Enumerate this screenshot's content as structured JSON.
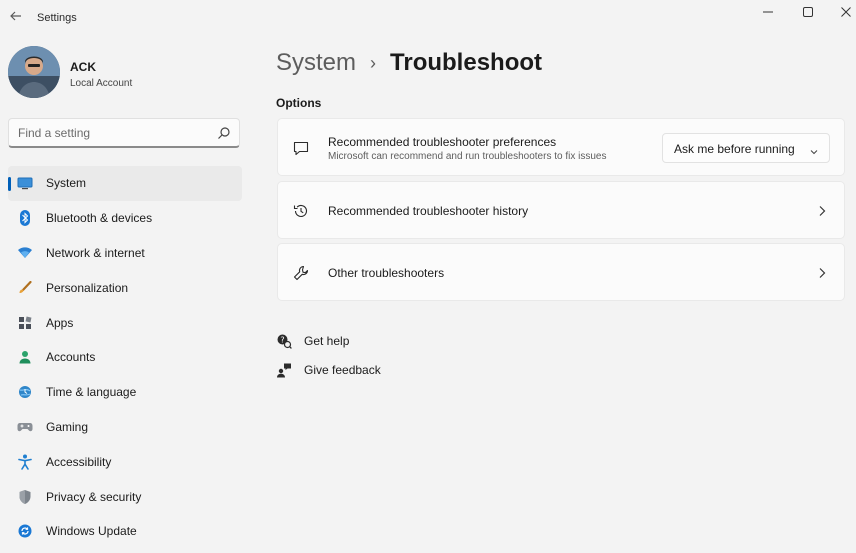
{
  "window": {
    "title": "Settings",
    "back_icon": "back-arrow-icon",
    "controls": [
      "minimize-icon",
      "maximize-icon",
      "close-icon"
    ]
  },
  "profile": {
    "name": "ACK",
    "account_type": "Local Account"
  },
  "search": {
    "placeholder": "Find a setting",
    "icon": "search-icon"
  },
  "sidebar": {
    "accent": "#005fb8",
    "items": [
      {
        "label": "System",
        "icon": "system-display-icon",
        "selected": true
      },
      {
        "label": "Bluetooth & devices",
        "icon": "bluetooth-icon"
      },
      {
        "label": "Network & internet",
        "icon": "wifi-icon"
      },
      {
        "label": "Personalization",
        "icon": "brush-icon"
      },
      {
        "label": "Apps",
        "icon": "apps-icon"
      },
      {
        "label": "Accounts",
        "icon": "person-icon"
      },
      {
        "label": "Time & language",
        "icon": "globe-clock-icon"
      },
      {
        "label": "Gaming",
        "icon": "gamepad-icon"
      },
      {
        "label": "Accessibility",
        "icon": "accessibility-icon"
      },
      {
        "label": "Privacy & security",
        "icon": "shield-icon"
      },
      {
        "label": "Windows Update",
        "icon": "update-icon"
      }
    ]
  },
  "breadcrumb": {
    "parent": "System",
    "separator": "›",
    "current": "Troubleshoot"
  },
  "main": {
    "section_title": "Options",
    "cards": [
      {
        "title": "Recommended troubleshooter preferences",
        "description": "Microsoft can recommend and run troubleshooters to fix issues",
        "icon": "message-icon",
        "dropdown_value": "Ask me before running"
      },
      {
        "title": "Recommended troubleshooter history",
        "icon": "history-icon"
      },
      {
        "title": "Other troubleshooters",
        "icon": "wrench-icon"
      }
    ],
    "links": [
      {
        "label": "Get help",
        "icon": "help-icon"
      },
      {
        "label": "Give feedback",
        "icon": "feedback-icon"
      }
    ]
  }
}
